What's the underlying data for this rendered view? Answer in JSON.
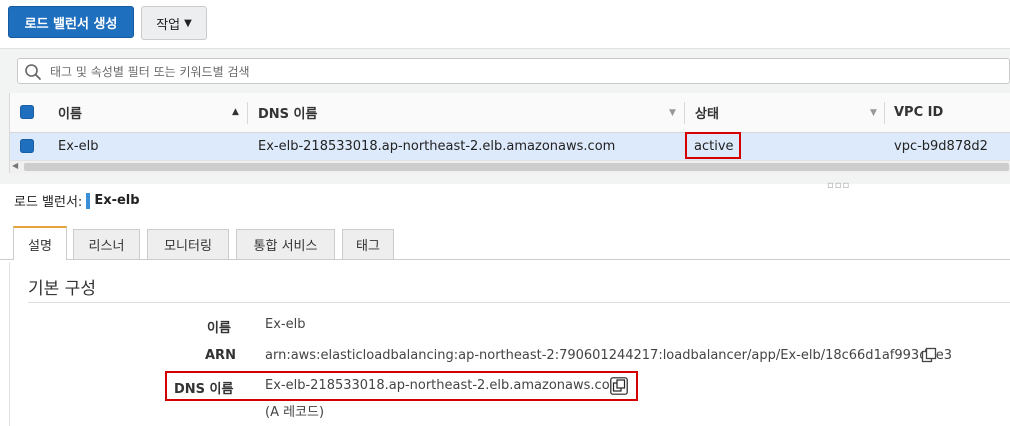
{
  "toolbar": {
    "create_lb_label": "로드 밸런서 생성",
    "actions_label": "작업"
  },
  "search": {
    "placeholder": "태그 및 속성별 필터 또는 키워드별 검색"
  },
  "table": {
    "columns": [
      "이름",
      "DNS 이름",
      "상태",
      "VPC ID"
    ],
    "rows": [
      {
        "name": "Ex-elb",
        "dns": "Ex-elb-218533018.ap-northeast-2.elb.amazonaws.com",
        "status": "active",
        "vpc": "vpc-b9d878d2"
      }
    ]
  },
  "detail": {
    "header_label": "로드 밸런서:",
    "header_name": "Ex-elb",
    "tabs": [
      "설명",
      "리스너",
      "모니터링",
      "통합 서비스",
      "태그"
    ],
    "section_title": "기본 구성",
    "fields": {
      "name_label": "이름",
      "name_value": "Ex-elb",
      "arn_label": "ARN",
      "arn_value": "arn:aws:elasticloadbalancing:ap-northeast-2:790601244217:loadbalancer/app/Ex-elb/18c66d1af993d6e3",
      "dns_label": "DNS 이름",
      "dns_value": "Ex-elb-218533018.ap-northeast-2.elb.amazonaws.com",
      "dns_note": "(A 레코드)"
    }
  },
  "colors": {
    "primary": "#1f6fbf",
    "highlight": "#d40000",
    "selected_row": "#ddeafb",
    "active_tab": "#e8a33d"
  }
}
